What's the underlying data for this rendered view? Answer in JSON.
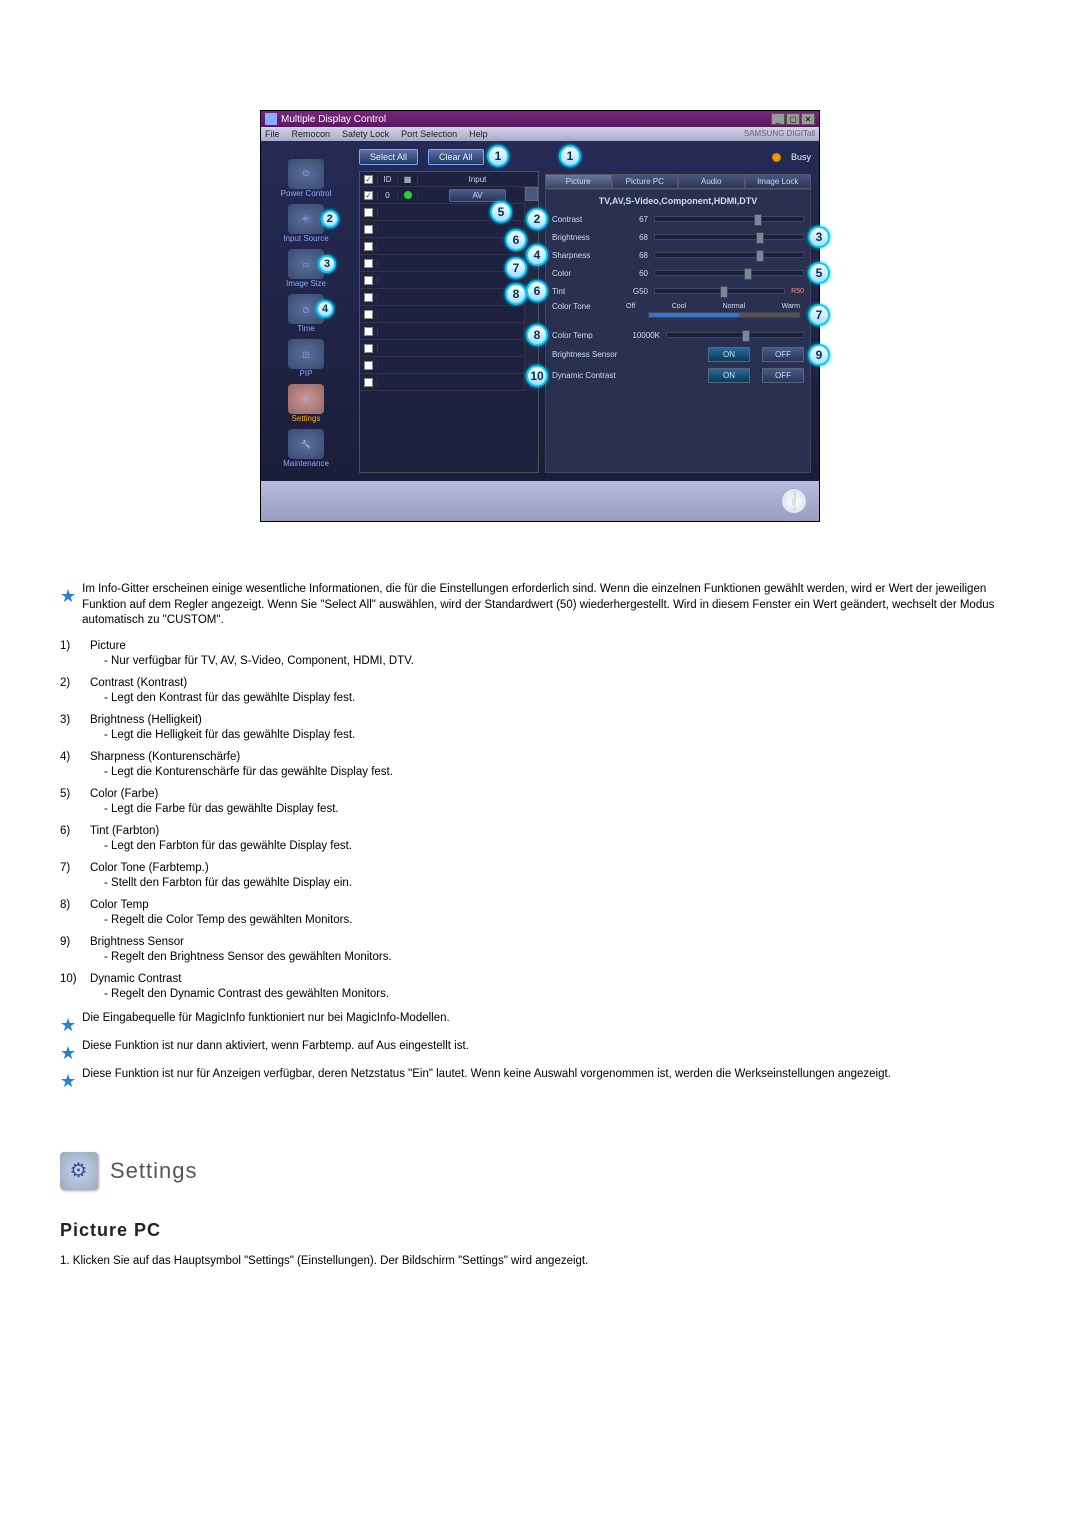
{
  "app": {
    "title": "Multiple Display Control",
    "brand": "SAMSUNG DIGITall"
  },
  "menu": [
    "File",
    "Remocon",
    "Safety Lock",
    "Port Selection",
    "Help"
  ],
  "toolbar": {
    "select_all": "Select All",
    "clear_all": "Clear All",
    "busy": "Busy"
  },
  "sidebar": {
    "power": "Power Control",
    "input": "Input Source",
    "image": "Image Size",
    "time": "Time",
    "pip": "PIP",
    "settings": "Settings",
    "maintenance": "Maintenance"
  },
  "sidebar_callouts": {
    "c2": "2",
    "c3": "3",
    "c4": "4"
  },
  "grid": {
    "headers": {
      "id": "ID",
      "input": "Input"
    },
    "row0": {
      "id": "0",
      "input": "AV"
    }
  },
  "grid_callouts": {
    "c1": "1",
    "c5": "5",
    "c6": "6",
    "c7": "7",
    "c8": "8"
  },
  "tabs": [
    "Picture",
    "Picture PC",
    "Audio",
    "Image Lock"
  ],
  "panel": {
    "head": "TV,AV,S-Video,Component,HDMI,DTV",
    "contrast": {
      "label": "Contrast",
      "value": "67"
    },
    "brightness": {
      "label": "Brightness",
      "value": "68"
    },
    "sharpness": {
      "label": "Sharpness",
      "value": "68"
    },
    "color": {
      "label": "Color",
      "value": "60"
    },
    "tint": {
      "label": "Tint",
      "value": "G50",
      "r": "R50"
    },
    "colortone": {
      "label": "Color Tone",
      "opts": [
        "Off",
        "Cool",
        "Normal",
        "Warm"
      ]
    },
    "colortemp": {
      "label": "Color Temp",
      "value": "10000K"
    },
    "bsensor": {
      "label": "Brightness Sensor",
      "on": "ON",
      "off": "OFF"
    },
    "dcontrast": {
      "label": "Dynamic Contrast",
      "on": "ON",
      "off": "OFF"
    }
  },
  "panel_callouts": {
    "c1": "1",
    "c2": "2",
    "c3": "3",
    "c4": "4",
    "c5": "5",
    "c6": "6",
    "c7": "7",
    "c8": "8",
    "c9": "9",
    "c10": "10"
  },
  "notes": {
    "intro": "Im Info-Gitter erscheinen einige wesentliche Informationen, die für die Einstellungen erforderlich sind. Wenn die einzelnen Funktionen gewählt werden, wird er Wert der jeweiligen Funktion auf dem Regler angezeigt. Wenn Sie \"Select All\" auswählen, wird der Standardwert (50) wiederhergestellt. Wird in diesem Fenster ein Wert geändert, wechselt der Modus automatisch zu \"CUSTOM\"."
  },
  "items": {
    "n1": "1)",
    "t1": "Picture",
    "s1": "- Nur verfügbar für TV, AV, S-Video, Component, HDMI, DTV.",
    "n2": "2)",
    "t2": "Contrast (Kontrast)",
    "s2": "- Legt den Kontrast für das gewählte Display fest.",
    "n3": "3)",
    "t3": "Brightness (Helligkeit)",
    "s3": "- Legt die Helligkeit für das gewählte Display fest.",
    "n4": "4)",
    "t4": "Sharpness (Konturenschärfe)",
    "s4": "- Legt die Konturenschärfe für das gewählte Display fest.",
    "n5": "5)",
    "t5": "Color (Farbe)",
    "s5": "- Legt die Farbe für das gewählte Display fest.",
    "n6": "6)",
    "t6": "Tint (Farbton)",
    "s6": "- Legt den Farbton für das gewählte Display fest.",
    "n7": "7)",
    "t7": "Color Tone (Farbtemp.)",
    "s7": "- Stellt den Farbton für das gewählte Display ein.",
    "n8": "8)",
    "t8": "Color Temp",
    "s8": "- Regelt die Color Temp des gewählten Monitors.",
    "n9": "9)",
    "t9": "Brightness Sensor",
    "s9": "- Regelt den Brightness Sensor des gewählten Monitors.",
    "n10": "10)",
    "t10": "Dynamic Contrast",
    "s10": "- Regelt den Dynamic Contrast des gewählten Monitors."
  },
  "footnotes": {
    "f1": "Die Eingabequelle für MagicInfo funktioniert nur bei MagicInfo-Modellen.",
    "f2": "Diese Funktion ist nur dann aktiviert, wenn Farbtemp. auf Aus eingestellt ist.",
    "f3": "Diese Funktion ist nur für Anzeigen verfügbar, deren Netzstatus \"Ein\" lautet. Wenn keine Auswahl vorgenommen ist, werden die Werkseinstellungen angezeigt."
  },
  "section": {
    "title": "Settings",
    "sub": "Picture PC",
    "p1": "1. Klicken Sie auf das Hauptsymbol \"Settings\" (Einstellungen). Der Bildschirm \"Settings\" wird angezeigt."
  }
}
